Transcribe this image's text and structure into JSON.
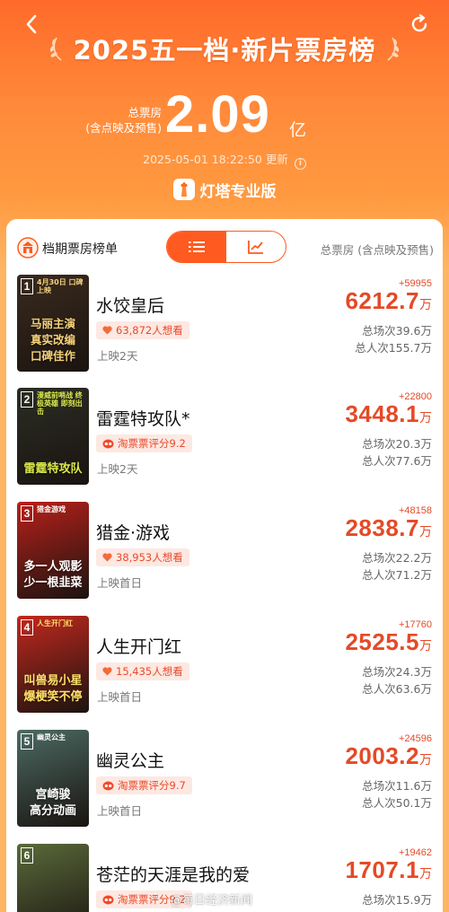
{
  "header": {
    "title": "2025五一档·新片票房榜",
    "total_label_line1": "总票房",
    "total_label_line2": "(含点映及预售)",
    "total_value": "2.09",
    "total_unit": "亿",
    "update_time": "2025-05-01 18:22:50",
    "update_suffix": "更新",
    "brand": "灯塔专业版"
  },
  "panel": {
    "title": "档期票房榜单",
    "right_label": "总票房 (含点映及预售)",
    "view_modes": [
      "list",
      "chart"
    ],
    "active_view": "list"
  },
  "films": [
    {
      "rank": "1",
      "name": "水饺皇后",
      "badge": "63,872人想看",
      "badge_type": "want",
      "release": "上映2天",
      "delta": "+59955",
      "box": "6212.7",
      "unit": "万",
      "sessions": "总场次39.6万",
      "viewers": "总人次155.7万",
      "poster_lines": [
        "马丽主演",
        "真实改编",
        "口碑佳作"
      ],
      "poster_top": "4月30日 口碑上映",
      "poster_bg": "#3a2a1e",
      "poster_fg": "#f6d27a"
    },
    {
      "rank": "2",
      "name": "雷霆特攻队*",
      "badge": "淘票票评分9.2",
      "badge_type": "score",
      "release": "上映2天",
      "delta": "+22800",
      "box": "3448.1",
      "unit": "万",
      "sessions": "总场次20.3万",
      "viewers": "总人次77.6万",
      "poster_lines": [
        "雷霆特攻队"
      ],
      "poster_top": "漫威前哨战 终极英雄 即刻出击",
      "poster_bg": "#2b2d24",
      "poster_fg": "#d9e84a"
    },
    {
      "rank": "3",
      "name": "猎金·游戏",
      "badge": "38,953人想看",
      "badge_type": "want",
      "release": "上映首日",
      "delta": "+48158",
      "box": "2838.7",
      "unit": "万",
      "sessions": "总场次22.2万",
      "viewers": "总人次71.2万",
      "poster_lines": [
        "多一人观影",
        "少一根韭菜"
      ],
      "poster_top": "猎金游戏",
      "poster_bg": "#b8201a",
      "poster_fg": "#ffffff"
    },
    {
      "rank": "4",
      "name": "人生开门红",
      "badge": "15,435人想看",
      "badge_type": "want",
      "release": "上映首日",
      "delta": "+17760",
      "box": "2525.5",
      "unit": "万",
      "sessions": "总场次24.3万",
      "viewers": "总人次63.6万",
      "poster_lines": [
        "叫兽易小星",
        "爆梗笑不停"
      ],
      "poster_top": "人生开门红",
      "poster_bg": "#c3281e",
      "poster_fg": "#ffe16a"
    },
    {
      "rank": "5",
      "name": "幽灵公主",
      "badge": "淘票票评分9.7",
      "badge_type": "score",
      "release": "上映首日",
      "delta": "+24596",
      "box": "2003.2",
      "unit": "万",
      "sessions": "总场次11.6万",
      "viewers": "总人次50.1万",
      "poster_lines": [
        "宫崎骏",
        "高分动画"
      ],
      "poster_top": "幽灵公主",
      "poster_bg": "#4d6a63",
      "poster_fg": "#ffffff"
    },
    {
      "rank": "6",
      "name": "苍茫的天涯是我的爱",
      "badge": "淘票票评分9.2",
      "badge_type": "score",
      "release": "",
      "delta": "+19462",
      "box": "1707.1",
      "unit": "万",
      "sessions": "总场次15.9万",
      "viewers": "",
      "poster_lines": [
        "苍茫的天涯是我的爱"
      ],
      "poster_top": "",
      "poster_bg": "#5a6a3a",
      "poster_fg": "#ffe16a"
    }
  ],
  "watermark": "@每日经济新闻",
  "colors": {
    "accent": "#ff5a1f",
    "price": "#e44a27"
  }
}
